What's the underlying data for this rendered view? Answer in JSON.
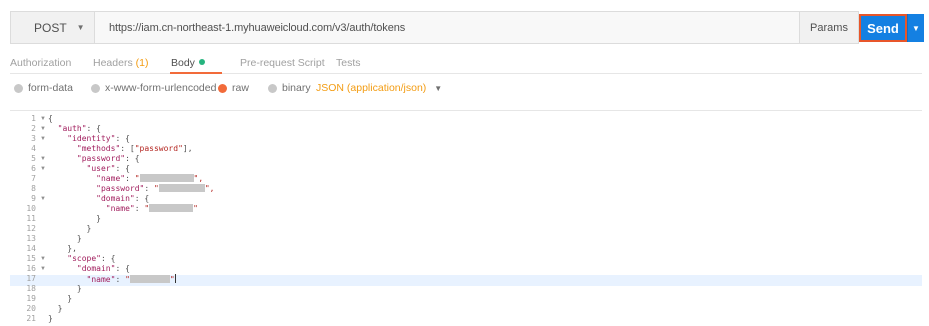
{
  "request": {
    "method": "POST",
    "url": "https://iam.cn-northeast-1.myhuaweicloud.com/v3/auth/tokens",
    "params_label": "Params",
    "send_label": "Send"
  },
  "tabs": [
    {
      "label": "Authorization",
      "count": ""
    },
    {
      "label": "Headers",
      "count": "(1)"
    },
    {
      "label": "Body",
      "count": ""
    },
    {
      "label": "Pre-request Script",
      "count": ""
    },
    {
      "label": "Tests",
      "count": ""
    }
  ],
  "active_tab": "Body",
  "body_types": [
    {
      "label": "form-data",
      "selected": false
    },
    {
      "label": "x-www-form-urlencoded",
      "selected": false
    },
    {
      "label": "raw",
      "selected": true
    },
    {
      "label": "binary",
      "selected": false
    }
  ],
  "content_type": "JSON (application/json)",
  "colors": {
    "send_bg": "#1480e2",
    "send_border": "#e8562a",
    "accent_orange": "#f26b3a",
    "body_dot": "#26b47f",
    "json_key": "#a11d5d",
    "json_string": "#b3241f"
  },
  "editor": {
    "active_line": 17,
    "lines": [
      {
        "n": "1",
        "fold": true,
        "parts": [
          {
            "t": "{",
            "c": "punc"
          }
        ]
      },
      {
        "n": "2",
        "fold": true,
        "parts": [
          {
            "t": "  ",
            "c": "punc"
          },
          {
            "t": "\"auth\"",
            "c": "key"
          },
          {
            "t": ": {",
            "c": "punc"
          }
        ]
      },
      {
        "n": "3",
        "fold": true,
        "parts": [
          {
            "t": "    ",
            "c": "punc"
          },
          {
            "t": "\"identity\"",
            "c": "key"
          },
          {
            "t": ": {",
            "c": "punc"
          }
        ]
      },
      {
        "n": "4",
        "fold": false,
        "parts": [
          {
            "t": "      ",
            "c": "punc"
          },
          {
            "t": "\"methods\"",
            "c": "key"
          },
          {
            "t": ": [",
            "c": "punc"
          },
          {
            "t": "\"password\"",
            "c": "str"
          },
          {
            "t": "],",
            "c": "punc"
          }
        ]
      },
      {
        "n": "5",
        "fold": true,
        "parts": [
          {
            "t": "      ",
            "c": "punc"
          },
          {
            "t": "\"password\"",
            "c": "key"
          },
          {
            "t": ": {",
            "c": "punc"
          }
        ]
      },
      {
        "n": "6",
        "fold": true,
        "parts": [
          {
            "t": "        ",
            "c": "punc"
          },
          {
            "t": "\"user\"",
            "c": "key"
          },
          {
            "t": ": {",
            "c": "punc"
          }
        ]
      },
      {
        "n": "7",
        "fold": false,
        "parts": [
          {
            "t": "          ",
            "c": "punc"
          },
          {
            "t": "\"name\"",
            "c": "key"
          },
          {
            "t": ": ",
            "c": "punc"
          },
          {
            "t": "\"",
            "c": "str"
          },
          {
            "redact": 54
          },
          {
            "t": "\",",
            "c": "str"
          }
        ]
      },
      {
        "n": "8",
        "fold": false,
        "parts": [
          {
            "t": "          ",
            "c": "punc"
          },
          {
            "t": "\"password\"",
            "c": "key"
          },
          {
            "t": ": ",
            "c": "punc"
          },
          {
            "t": "\"",
            "c": "str"
          },
          {
            "redact": 46
          },
          {
            "t": "\",",
            "c": "str"
          }
        ]
      },
      {
        "n": "9",
        "fold": true,
        "parts": [
          {
            "t": "          ",
            "c": "punc"
          },
          {
            "t": "\"domain\"",
            "c": "key"
          },
          {
            "t": ": {",
            "c": "punc"
          }
        ]
      },
      {
        "n": "10",
        "fold": false,
        "parts": [
          {
            "t": "            ",
            "c": "punc"
          },
          {
            "t": "\"name\"",
            "c": "key"
          },
          {
            "t": ": ",
            "c": "punc"
          },
          {
            "t": "\"",
            "c": "str"
          },
          {
            "redact": 44
          },
          {
            "t": "\"",
            "c": "str"
          }
        ]
      },
      {
        "n": "11",
        "fold": false,
        "parts": [
          {
            "t": "          }",
            "c": "punc"
          }
        ]
      },
      {
        "n": "12",
        "fold": false,
        "parts": [
          {
            "t": "        }",
            "c": "punc"
          }
        ]
      },
      {
        "n": "13",
        "fold": false,
        "parts": [
          {
            "t": "      }",
            "c": "punc"
          }
        ]
      },
      {
        "n": "14",
        "fold": false,
        "parts": [
          {
            "t": "    },",
            "c": "punc"
          }
        ]
      },
      {
        "n": "15",
        "fold": true,
        "parts": [
          {
            "t": "    ",
            "c": "punc"
          },
          {
            "t": "\"scope\"",
            "c": "key"
          },
          {
            "t": ": {",
            "c": "punc"
          }
        ]
      },
      {
        "n": "16",
        "fold": true,
        "parts": [
          {
            "t": "      ",
            "c": "punc"
          },
          {
            "t": "\"domain\"",
            "c": "key"
          },
          {
            "t": ": {",
            "c": "punc"
          }
        ]
      },
      {
        "n": "17",
        "fold": false,
        "parts": [
          {
            "t": "        ",
            "c": "punc"
          },
          {
            "t": "\"name\"",
            "c": "key"
          },
          {
            "t": ": ",
            "c": "punc"
          },
          {
            "t": "\"",
            "c": "str"
          },
          {
            "redact": 40
          },
          {
            "t": "\"",
            "c": "str"
          },
          {
            "cursor": true
          }
        ]
      },
      {
        "n": "18",
        "fold": false,
        "parts": [
          {
            "t": "      }",
            "c": "punc"
          }
        ]
      },
      {
        "n": "19",
        "fold": false,
        "parts": [
          {
            "t": "    }",
            "c": "punc"
          }
        ]
      },
      {
        "n": "20",
        "fold": false,
        "parts": [
          {
            "t": "  }",
            "c": "punc"
          }
        ]
      },
      {
        "n": "21",
        "fold": false,
        "parts": [
          {
            "t": "}",
            "c": "punc"
          }
        ]
      }
    ]
  }
}
